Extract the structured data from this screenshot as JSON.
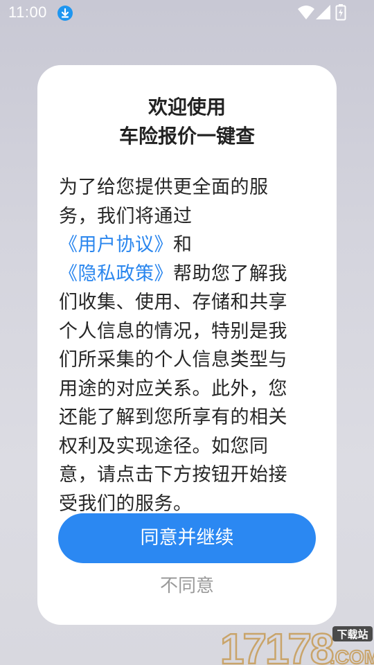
{
  "status_bar": {
    "time": "11:00",
    "icons": [
      "download-icon",
      "wifi-icon",
      "signal-icon",
      "battery-icon"
    ]
  },
  "dialog": {
    "title_line1": "欢迎使用",
    "title_line2": "车险报价一键查",
    "body": {
      "text_1": "为了给您提供更全面的服务，我们将通过",
      "link_user_agreement": "《用户协议》",
      "text_2": "和",
      "link_privacy_policy": "《隐私政策》",
      "text_3": "帮助您了解我们收集、使用、存储和共享个人信息的情况，特别是我们所采集的个人信息类型与用途的对应关系。此外，您还能了解到您所享有的相关权利及实现途径。如您同意，请点击下方按钮开始接受我们的服务。"
    },
    "agree_button_label": "同意并继续",
    "disagree_button_label": "不同意"
  },
  "watermark": {
    "text": "17178",
    "suffix": ".COM",
    "badge": "下载站"
  },
  "colors": {
    "accent": "#2b88f2",
    "link": "#2a86ee",
    "disagree_text": "#9a9a9a"
  }
}
